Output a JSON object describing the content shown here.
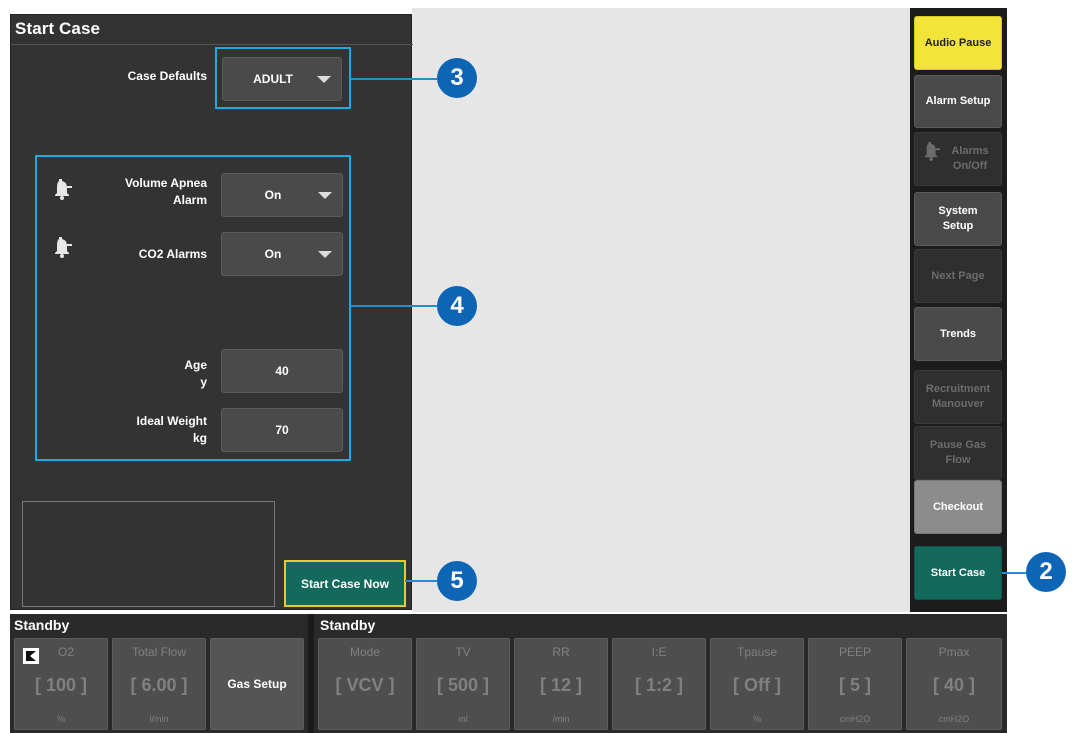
{
  "panel": {
    "title": "Start Case",
    "case_defaults_label": "Case Defaults",
    "case_defaults_value": "ADULT",
    "volume_apnea_label_line1": "Volume Apnea",
    "volume_apnea_label_line2": "Alarm",
    "volume_apnea_value": "On",
    "co2_label": "CO2 Alarms",
    "co2_value": "On",
    "age_label": "Age",
    "age_unit": "y",
    "age_value": "40",
    "ideal_weight_label": "Ideal Weight",
    "ideal_weight_unit": "kg",
    "ideal_weight_value": "70",
    "start_now_label": "Start Case Now"
  },
  "callouts": {
    "c2": "2",
    "c3": "3",
    "c4": "4",
    "c5": "5"
  },
  "sidebar": {
    "audio_pause": "Audio Pause",
    "alarm_setup": "Alarm Setup",
    "alarms_onoff_line1": "Alarms",
    "alarms_onoff_line2": "On/Off",
    "system_setup_line1": "System",
    "system_setup_line2": "Setup",
    "next_page": "Next Page",
    "trends": "Trends",
    "recruitment_line1": "Recruitment",
    "recruitment_line2": "Manouver",
    "pause_gas_line1": "Pause Gas",
    "pause_gas_line2": "Flow",
    "checkout": "Checkout",
    "start_case": "Start Case"
  },
  "bottom": {
    "left_header": "Standby",
    "right_header": "Standby",
    "o2": {
      "name": "O2",
      "value": "[ 100 ]",
      "unit": "%"
    },
    "total_flow": {
      "name": "Total Flow",
      "value": "[ 6.00 ]",
      "unit": "l/min"
    },
    "gas_setup": "Gas Setup",
    "mode": {
      "name": "Mode",
      "value": "[ VCV ]",
      "unit": ""
    },
    "tv": {
      "name": "TV",
      "value": "[ 500 ]",
      "unit": "ml"
    },
    "rr": {
      "name": "RR",
      "value": "[ 12 ]",
      "unit": "/min"
    },
    "ie": {
      "name": "I:E",
      "value": "[ 1:2 ]",
      "unit": ""
    },
    "tpause": {
      "name": "Tpause",
      "value": "[ Off ]",
      "unit": "%"
    },
    "peep": {
      "name": "PEEP",
      "value": "[ 5 ]",
      "unit": "cmH2O"
    },
    "pmax": {
      "name": "Pmax",
      "value": "[ 40 ]",
      "unit": "cmH2O"
    }
  },
  "colors": {
    "panel_bg": "#333333",
    "highlight_blue": "#1ea7e1",
    "callout_blue": "#0f65b5",
    "start_green": "#13695c",
    "audio_yellow": "#f3e43a"
  }
}
